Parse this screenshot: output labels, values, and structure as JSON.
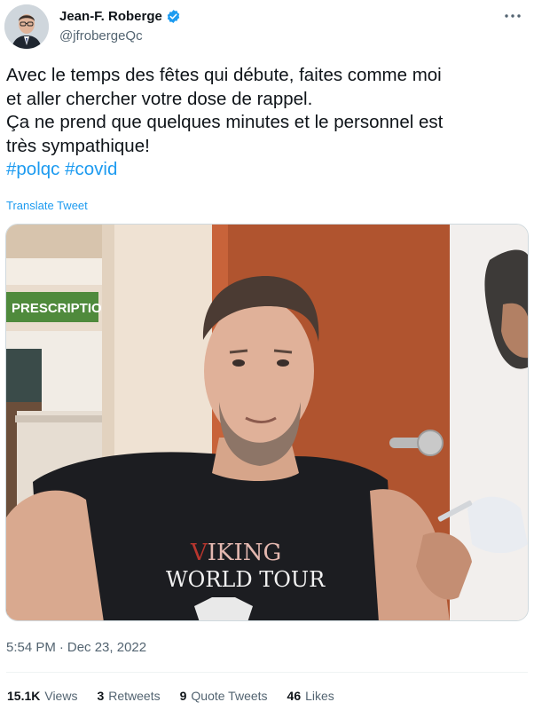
{
  "author": {
    "display_name": "Jean-F. Roberge",
    "handle": "@jfrobergeQc",
    "verified": true
  },
  "tweet": {
    "lines": [
      "Avec le temps des fêtes qui débute, faites comme moi",
      "et aller chercher votre dose de rappel.",
      "Ça ne prend que quelques minutes et le personnel est",
      "très sympathique!"
    ],
    "hashtags": [
      "#polqc",
      "#covid"
    ],
    "translate_label": "Translate Tweet"
  },
  "media": {
    "sign_text": "PRESCRIPTIONS",
    "shirt_line1": "IKING",
    "shirt_line2": "ORLD TOUR",
    "shirt_initial1": "V",
    "shirt_initial2": "W"
  },
  "meta": {
    "time": "5:54 PM",
    "separator": "·",
    "date": "Dec 23, 2022"
  },
  "stats": [
    {
      "value": "15.1K",
      "label": "Views"
    },
    {
      "value": "3",
      "label": "Retweets"
    },
    {
      "value": "9",
      "label": "Quote Tweets"
    },
    {
      "value": "46",
      "label": "Likes"
    }
  ],
  "colors": {
    "accent": "#1d9bf0",
    "secondary_text": "#536471",
    "primary_text": "#0f1419"
  },
  "icons": [
    "verified-badge-icon",
    "more-options-icon"
  ]
}
